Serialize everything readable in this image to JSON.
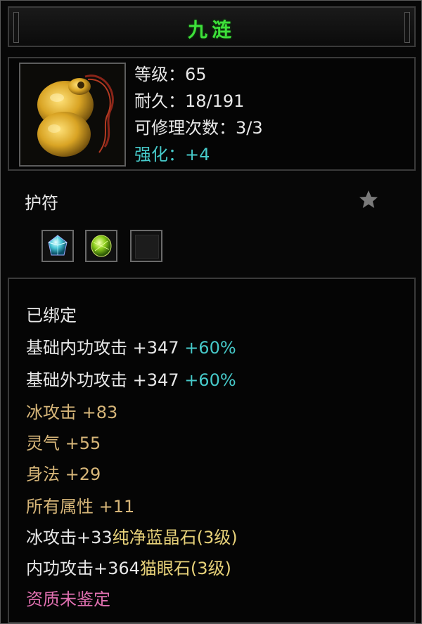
{
  "item": {
    "name": "九涟",
    "type": "护符",
    "stats": {
      "level": "等级：65",
      "durability": "耐久：18/191",
      "repairs": "可修理次数：3/3",
      "enhance": "强化：+4"
    }
  },
  "sockets": [
    {
      "gem": "blue-diamond-gem"
    },
    {
      "gem": "green-cat-eye-gem"
    },
    {
      "gem": "empty"
    }
  ],
  "attributes": {
    "bound": "已绑定",
    "inner_attack_label": "基础内功攻击  +347",
    "inner_attack_bonus": "+60%",
    "outer_attack_label": "基础外功攻击  +347",
    "outer_attack_bonus": "+60%",
    "ice_attack": "冰攻击  +83",
    "spirit": "灵气  +55",
    "agility": "身法  +29",
    "all_attributes": "所有属性  +11",
    "gem1_prefix": "冰攻击+33",
    "gem1_name": "纯净蓝晶石(3级)",
    "gem2_prefix": "内功攻击+364",
    "gem2_name": "猫眼石(3级)",
    "quality": "资质未鉴定"
  },
  "colors": {
    "title": "#3ee03a",
    "enhance": "#46c9c9",
    "gold": "#d7b679",
    "gem_name": "#e8d27a",
    "quality": "#e070b0"
  }
}
